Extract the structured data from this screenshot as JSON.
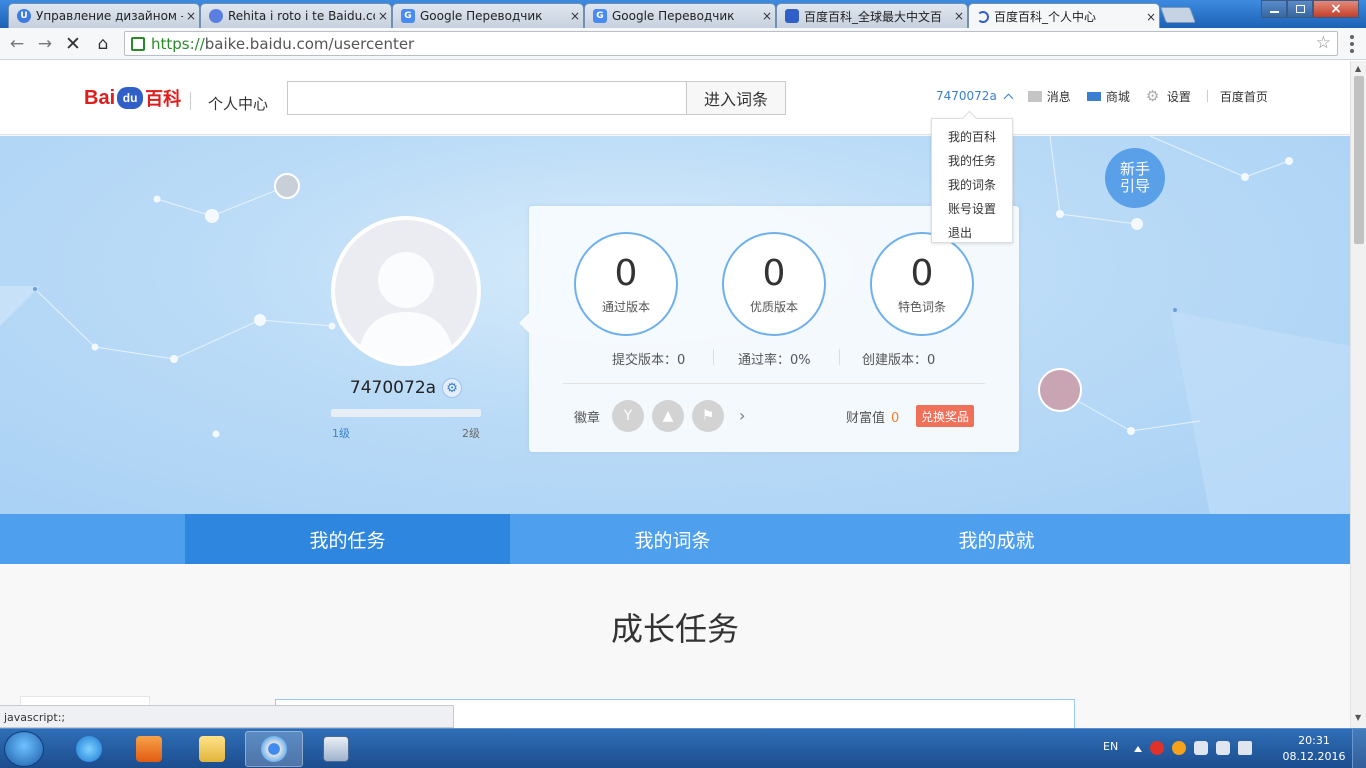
{
  "browser": {
    "tabs": [
      {
        "title": "Управление дизайном - ",
        "favicon": "U",
        "favicon_color": "#3d7be0"
      },
      {
        "title": "Rehita i roto i te Baidu.com",
        "favicon": "baidu-translate-icon",
        "favicon_color": "#5a7fe0"
      },
      {
        "title": "Google Переводчик",
        "favicon": "G",
        "favicon_color": "#4a8af4"
      },
      {
        "title": "Google Переводчик",
        "favicon": "G",
        "favicon_color": "#4a8af4"
      },
      {
        "title": "百度百科_全球最大中文百",
        "favicon": "baidu-paw-icon",
        "favicon_color": "#2f5fc7"
      },
      {
        "title": "百度百科_个人中心",
        "favicon": "loading-icon",
        "favicon_color": "#2f5fc7"
      }
    ],
    "close_glyph": "×",
    "url_scheme": "https://",
    "url_rest": "baike.baidu.com/usercenter",
    "status_text": "javascript:;"
  },
  "header": {
    "logo_bai": "Bai",
    "logo_du": "du",
    "logo_baike": "百科",
    "center_label": "个人中心",
    "search_placeholder": "",
    "search_button": "进入词条",
    "username": "7470072a",
    "messages": "消息",
    "mall": "商城",
    "settings": "设置",
    "home": "百度首页"
  },
  "dropdown": {
    "items": [
      "我的百科",
      "我的任务",
      "我的词条",
      "账号设置",
      "退出"
    ]
  },
  "banner": {
    "guide_button": "新手引导",
    "username": "7470072a",
    "level_current": "1级",
    "level_next": "2级",
    "level_progress": 0
  },
  "stats": {
    "circles": [
      {
        "value": "0",
        "label": "通过版本"
      },
      {
        "value": "0",
        "label": "优质版本"
      },
      {
        "value": "0",
        "label": "特色词条"
      }
    ],
    "submitted": "提交版本：0",
    "pass_rate": "通过率：0%",
    "created": "创建版本：0",
    "badges_label": "徽章",
    "wealth_label": "财富值",
    "wealth_value": "0",
    "redeem_button": "兑换奖品"
  },
  "page_tabs": [
    "我的任务",
    "我的词条",
    "我的成就"
  ],
  "section_title": "成长任务",
  "taskbar": {
    "lang": "EN",
    "time": "20:31",
    "date": "08.12.2016"
  },
  "colors": {
    "accent": "#4ea0ef",
    "accent_dark": "#2f86de",
    "logo_red": "#de1d1d",
    "wealth_orange": "#f57c2b",
    "redeem_red": "#f0705a"
  }
}
